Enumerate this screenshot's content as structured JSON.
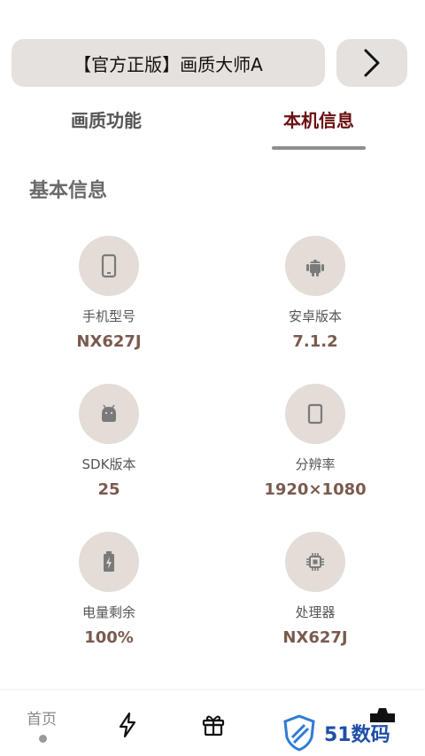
{
  "header": {
    "title": "【官方正版】画质大师A"
  },
  "tabs": [
    {
      "label": "画质功能",
      "active": false
    },
    {
      "label": "本机信息",
      "active": true
    }
  ],
  "section": {
    "title": "基本信息"
  },
  "info": [
    {
      "label": "手机型号",
      "value": "NX627J",
      "icon": "phone-icon"
    },
    {
      "label": "安卓版本",
      "value": "7.1.2",
      "icon": "android-icon"
    },
    {
      "label": "SDK版本",
      "value": "25",
      "icon": "android-head-icon"
    },
    {
      "label": "分辨率",
      "value": "1920×1080",
      "icon": "screen-icon"
    },
    {
      "label": "电量剩余",
      "value": "100%",
      "icon": "battery-icon"
    },
    {
      "label": "处理器",
      "value": "NX627J",
      "icon": "chip-icon"
    }
  ],
  "bottom_nav": {
    "home_label": "首页"
  },
  "watermark": {
    "text": "51数码"
  },
  "colors": {
    "accent": "#6b0f0f",
    "circle_bg": "#e3dcd7",
    "value_color": "#7a5a4e",
    "pill_bg": "#e5e1de"
  }
}
